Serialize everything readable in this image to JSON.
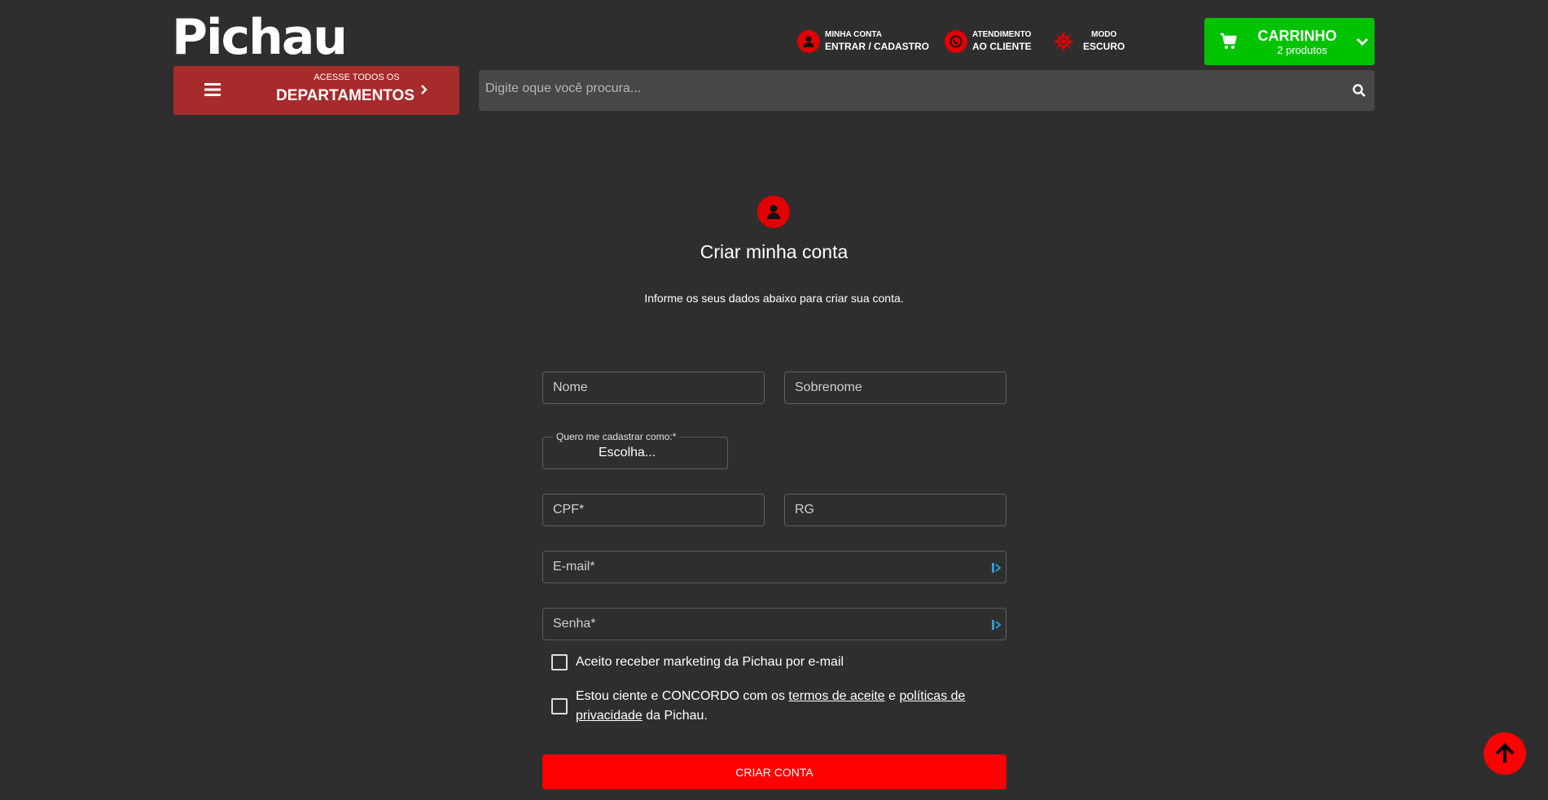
{
  "header": {
    "logo": "Pichau",
    "account": {
      "small": "MINHA CONTA",
      "big": "ENTRAR / CADASTRO",
      "icon": "user-icon"
    },
    "support": {
      "small": "ATENDIMENTO",
      "big": "AO CLIENTE",
      "icon": "whatsapp-icon"
    },
    "mode": {
      "small": "MODO",
      "big": "ESCURO",
      "icon": "sun-icon"
    },
    "cart": {
      "title": "CARRINHO",
      "subtitle": "2 produtos",
      "icon": "cart-icon"
    },
    "departments": {
      "small": "ACESSE TODOS OS",
      "big": "DEPARTAMENTOS"
    },
    "search": {
      "placeholder": "Digite oque você procura..."
    }
  },
  "form": {
    "title": "Criar minha conta",
    "subtitle": "Informe os seus dados abaixo para criar sua conta.",
    "first_name_placeholder": "Nome",
    "last_name_placeholder": "Sobrenome",
    "register_as_label": "Quero me cadastrar como:*",
    "register_as_value": "Escolha...",
    "cpf_placeholder": "CPF*",
    "rg_placeholder": "RG",
    "email_placeholder": "E-mail*",
    "password_placeholder": "Senha*",
    "marketing_label": "Aceito receber marketing da Pichau por e-mail",
    "terms": {
      "prefix": "Estou ciente e CONCORDO com os ",
      "terms_link": "termos de aceite",
      "and": " e ",
      "privacy_link": "políticas de privacidade",
      "suffix": " da Pichau."
    },
    "submit_label": "CRIAR CONTA"
  },
  "colors": {
    "background": "#2e2e2e",
    "accent_red": "#ff0000",
    "cart_green": "#00c300",
    "departments_red": "#a72b2b"
  }
}
